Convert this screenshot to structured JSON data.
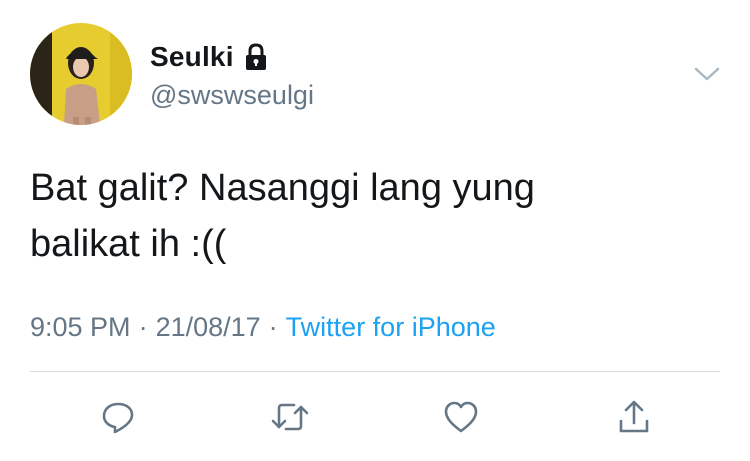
{
  "user": {
    "display_name": "Seulki",
    "handle": "@swswseulgi",
    "protected_icon": "lock-icon"
  },
  "tweet": {
    "text_line1": "Bat galit? Nasanggi lang yung",
    "text_line2": "balikat ih :(("
  },
  "meta": {
    "time": "9:05 PM",
    "separator": "·",
    "date": "21/08/17",
    "source": "Twitter for iPhone"
  },
  "actions": {
    "reply_icon": "reply-icon",
    "retweet_icon": "retweet-icon",
    "like_icon": "heart-icon",
    "share_icon": "share-icon"
  },
  "colors": {
    "text_primary": "#14171a",
    "text_secondary": "#657786",
    "link": "#1da1f2",
    "icon": "#657786",
    "divider": "#d6dde3",
    "avatar_background": "#e6cc2e"
  }
}
